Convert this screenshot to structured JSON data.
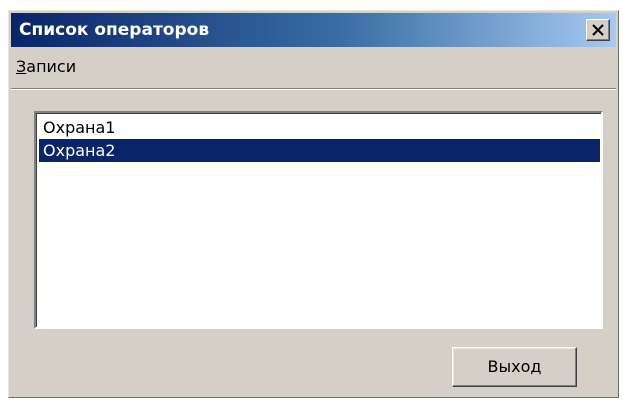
{
  "window": {
    "title": "Список операторов",
    "close_symbol": "×"
  },
  "menu": {
    "items": [
      {
        "label_first": "З",
        "label_rest": "аписи",
        "accelerator": "З"
      }
    ]
  },
  "list": {
    "items": [
      {
        "label": "Охрана1",
        "selected": false
      },
      {
        "label": "Охрана2",
        "selected": true
      }
    ]
  },
  "buttons": {
    "exit_label": "Выход"
  },
  "colors": {
    "titlebar_start": "#0a246a",
    "titlebar_end": "#a6caf0",
    "face": "#d4d0c8",
    "selection": "#0a246a"
  }
}
